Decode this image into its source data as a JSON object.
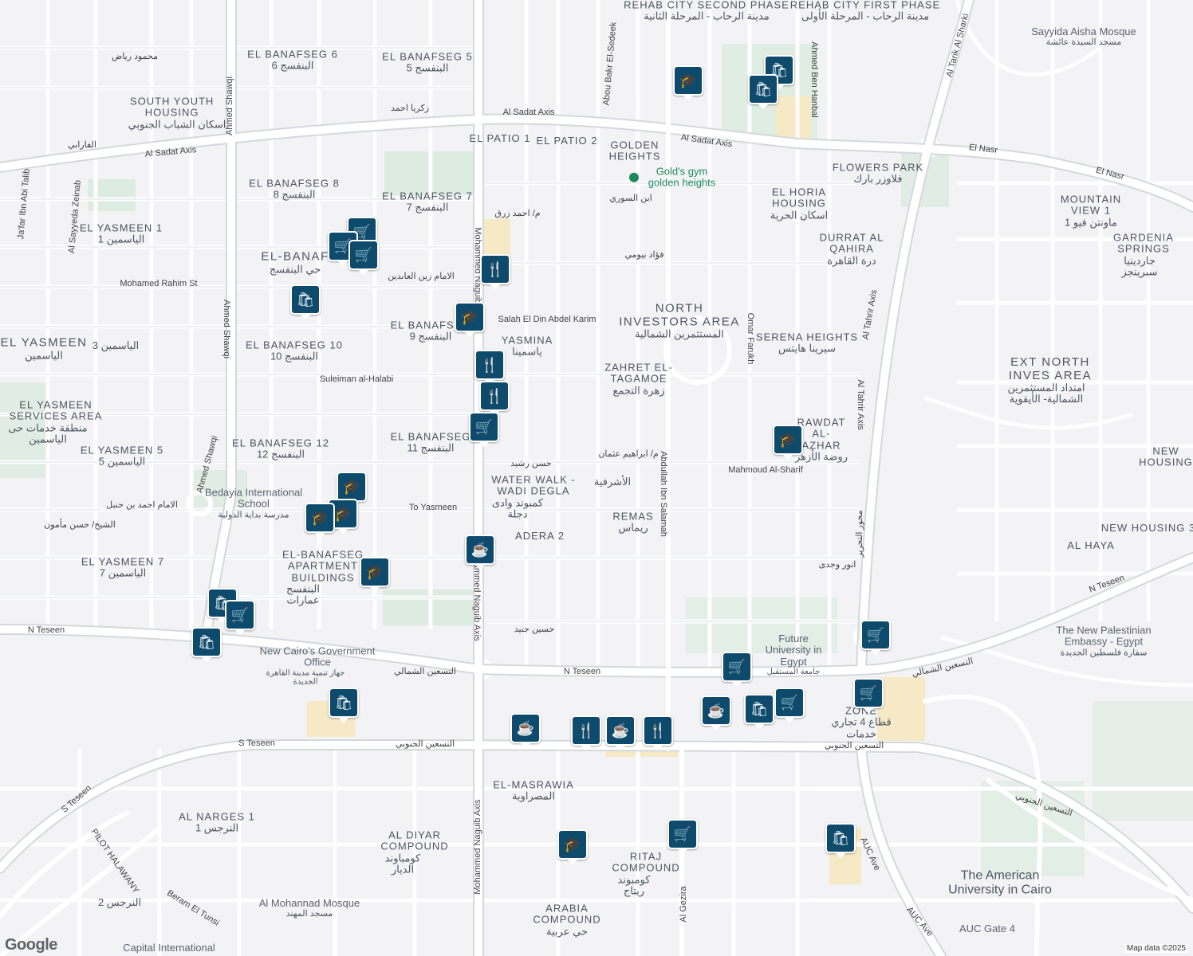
{
  "map": {
    "attribution": "Google",
    "map_data": "Map data ©2025",
    "colors": {
      "background": "#f3f3f5",
      "major_road": "#ffffff",
      "road_outline": "#d4d8dd",
      "green": "#cfe8d4",
      "commercial": "#f6e9c6",
      "pin": "#0d4a6b"
    }
  },
  "areas": {
    "rehab2": "REHAB CITY SECOND PHASE",
    "rehab2_ar": "مدينة الرحاب - المرحلة الثانية",
    "rehab1": "REHAB CITY FIRST PHASE",
    "rehab1_ar": "مدينة الرحاب - المرحلة الأولى",
    "banafseg6": "EL BANAFSEG 6",
    "banafseg6_ar": "البنفسج 6",
    "banafseg5": "EL BANAFSEG 5",
    "banafseg5_ar": "البنفسج 5",
    "south_youth": "SOUTH YOUTH HOUSING",
    "south_youth_ar": "اسكان الشباب الجنوبي",
    "patio1": "EL PATIO 1",
    "patio2": "EL PATIO 2",
    "golden_heights": "GOLDEN HEIGHTS",
    "banafseg8": "EL BANAFSEG 8",
    "banafseg8_ar": "البنفسج 8",
    "banafseg7": "EL BANAFSEG 7",
    "banafseg7_ar": "البنفسج 7",
    "yasmeen1": "EL YASMEEN 1",
    "yasmeen1_ar": "الياسمين 1",
    "el_banafseg": "EL-BANAF",
    "el_banafseg_ar": "حي البنفسج",
    "north_investors": "NORTH INVESTORS AREA",
    "north_investors_ar": "المستثمرين الشمالية",
    "banafseg9": "EL BANAFSEG",
    "banafseg9_ar": "البنفسج 9",
    "yasmina": "YASMINA",
    "yasmina_ar": "ياسمينا",
    "el_yasmeen": "EL YASMEEN",
    "el_yasmeen_ar": "الياسمين",
    "yasmeen3_ar": "الياسمين 3",
    "banafseg10": "EL BANAFSEG 10",
    "banafseg10_ar": "البنفسج 10",
    "zahret": "ZAHRET EL-TAGAMOE",
    "zahret_ar": "زهرة التجمع",
    "serena": "SERENA HEIGHTS",
    "serena_ar": "سيرينا هايتس",
    "ext_north": "EXT NORTH INVES AREA",
    "ext_north_ar": "امتداد المستثمرين الشمالية- الأيقوية",
    "yasmeen_services": "EL YASMEEN SERVICES AREA",
    "yasmeen_services_ar": "منطقة خدمات حى الياسمين",
    "banafseg12": "EL BANAFSEG 12",
    "banafseg12_ar": "البنفسج 12",
    "banafseg11": "EL BANAFSEG",
    "banafseg11_ar": "البنفسج 11",
    "yasmeen5": "EL YASMEEN 5",
    "yasmeen5_ar": "الياسمين 5",
    "rawdat": "RAWDAT AL-AZHAR",
    "rawdat_ar": "روضة الأزهر",
    "new_housing": "NEW HOUSING",
    "water_walk": "WATER WALK - WADI DEGLA",
    "water_walk_ar": "كمبوند وادى دجلة",
    "ashrafia_ar": "الأشرفية",
    "remas": "REMAS",
    "remas_ar": "ريماس",
    "new_housing3": "NEW HOUSING 3",
    "adera2": "ADERA 2",
    "yasmeen7": "EL YASMEEN 7",
    "yasmeen7_ar": "الياسمين 7",
    "banafseg_apts": "EL-BANAFSEG APARTMENT BUILDINGS",
    "banafseg_apts_ar": "البنفسج عمارات",
    "al_haya": "AL HAYA",
    "flowers_park": "FLOWERS PARK",
    "flowers_park_ar": "فلاوزر بارك",
    "horia": "EL HORIA HOUSING",
    "horia_ar": "اسكان الحرية",
    "durrat": "DURRAT AL QAHIRA",
    "durrat_ar": "درة القاهرة",
    "mountain_view": "MOUNTAIN VIEW 1",
    "mountain_view_ar": "ماونتن فيو 1",
    "gardenia": "GARDENIA SPRINGS",
    "gardenia_ar": "جاردينيا سبرينجز",
    "masrawia": "EL-MASRAWIA",
    "masrawia_ar": "المصراوية",
    "narges1": "AL NARGES 1",
    "narges1_ar": "النرجس 1",
    "al_diyar": "AL DIYAR COMPOUND",
    "al_diyar_ar": "كومباوند الديار",
    "ritaj": "RITAJ COMPOUND",
    "ritaj_ar": "كومبوند ريتاج",
    "arabia": "ARABIA COMPOUND",
    "arabia_ar": "حي عربية",
    "narges2_ar": "النرجس 2",
    "zone4": "ZONE",
    "zone4_ar": "قطاع 4 تجاري خدمات",
    "auc": "The American University in Cairo"
  },
  "streets": {
    "sadat_axis": "Al Sadat Axis",
    "el_nasr": "El Nasr",
    "n_teseen": "N Teseen",
    "s_teseen": "S Teseen",
    "n_teseen_ar": "التسعين الشمالي",
    "s_teseen_ar": "التسعين الجنوبي",
    "mohammed_naguib": "Mohammed Naguib Axis",
    "ahmed_shawqi": "Ahmed Shawqi",
    "al_tahrir_axis": "Al Tahrir Axis",
    "al_tarik": "Al Tarik Al Sharki",
    "abou_bakr": "Abou Bakr El-Sedeek",
    "ahmed_ben_hanbal": "Ahmed Ben Hanbal",
    "salah_el_din": "Salah El Din Abdel Karim",
    "suleiman": "Suleiman al-Halabi",
    "mohamed_rahim": "Mohamed Rahim St",
    "to_yasmeen": "To Yasmeen",
    "mahmoud_sharif": "Mahmoud Al-Sharif",
    "abdullah_salamah": "Abdullah Ibn Salamah",
    "omar_farukh": "Omar Farukh",
    "al_gezira": "Al Gezira",
    "auc_ave": "AUC Ave",
    "pilot_halawany": "PILOT HALAWANY",
    "beram": "Beram El Tunsi",
    "jafar": "Ja'far Ibn Abi Talib",
    "sayyeda": "Al Sayyeda Zeinab",
    "zakaria": "زكريا احمد",
    "ahmed_zaki": "م/ احمد زرق",
    "fouad": "فؤاد بيومي",
    "ibn_sory": "ابن السوري",
    "hassan_rashid": "حسن رشيد",
    "hussein_gened": "حسين جنيد",
    "ibrahim_othman": "م/ ابراهيم عثمان",
    "anwar_wagdy": "انور وجدى",
    "farabi": "الفارابي",
    "mohamed_riad": "محمود رياض",
    "imam_zein": "الامام زين العابدين",
    "imam_ahmed": "الامام احمد بن حنبل",
    "hasan_mamoun": "الشيخ/ حسن مأمون",
    "mehwar_tahrir_ar": "محور التحرير"
  },
  "pois": {
    "golds_gym": "Gold's gym golden heights",
    "sayyida_aisha": "Sayyida Aisha Mosque",
    "sayyida_aisha_ar": "مسجد السيدة عائشة",
    "bedayia": "Bedayia International School",
    "bedayia_ar": "مدرسة بداية الدولية",
    "govt_office": "New Cairo's Government Office",
    "govt_office_ar": "جهاز تنمية مدينة القاهرة الجديدة",
    "future_univ": "Future University in Egypt",
    "future_univ_ar": "جامعة المستقبل",
    "palestinian": "The New Palestinian Embassy - Egypt",
    "palestinian_ar": "سفارة فلسطين الجديدة",
    "al_mohannad": "Al Mohannad Mosque",
    "al_mohannad_ar": "مسجد المهند",
    "auc_gate": "AUC Gate 4",
    "capital_intl": "Capital International"
  }
}
